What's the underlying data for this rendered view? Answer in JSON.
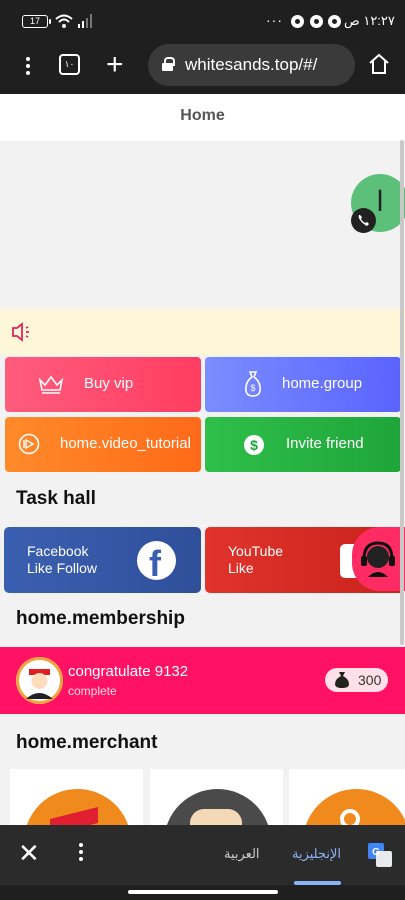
{
  "statusbar": {
    "battery": "17",
    "time": "١٢:٢٧ ص",
    "more": "···"
  },
  "browser": {
    "tab_count": "١٠",
    "url": "whitesands.top/#/"
  },
  "page": {
    "title": "Home"
  },
  "floating": {
    "avatar_letter": "ا"
  },
  "actions": {
    "buy_vip": "Buy vip",
    "group": "home.group",
    "video_tutorial": "home.video_tutorial",
    "invite_friend": "Invite friend"
  },
  "sections": {
    "task_hall": "Task hall",
    "membership": "home.membership",
    "merchant": "home.merchant"
  },
  "tasks": [
    {
      "line1": "Facebook",
      "line2": "Like Follow"
    },
    {
      "line1": "YouTube",
      "line2": "Like"
    }
  ],
  "member": {
    "name": "congratulate 9132",
    "status": "complete",
    "amount": "300"
  },
  "translate": {
    "arabic": "العربية",
    "english": "الإنجليزية"
  },
  "colors": {
    "brand_pink": "#ff1264",
    "notice_bg": "#fdf7d8"
  }
}
